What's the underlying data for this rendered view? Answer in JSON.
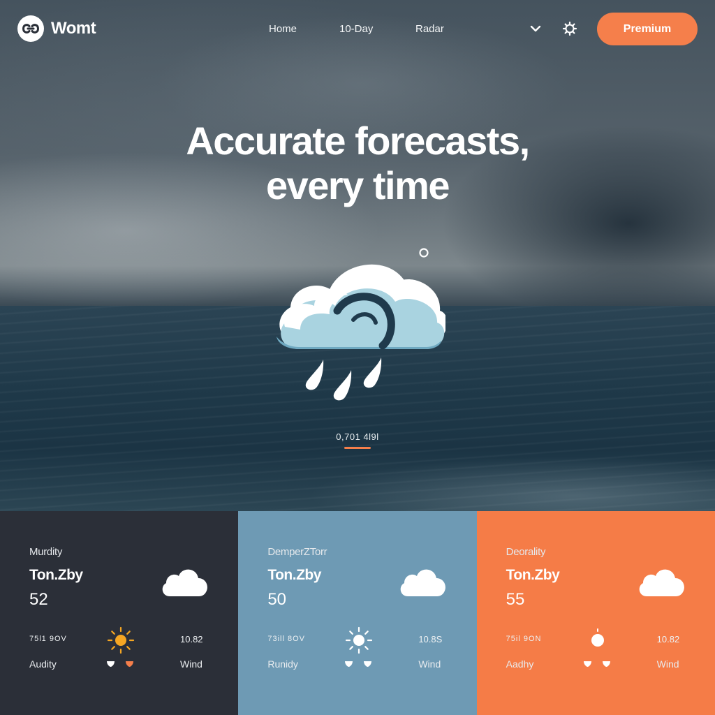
{
  "brand": {
    "name": "Womt"
  },
  "nav": {
    "links": [
      "Home",
      "10-Day",
      "Radar"
    ],
    "premium_label": "Premium"
  },
  "hero": {
    "headline_line1": "Accurate forecasts,",
    "headline_line2": "every time",
    "caption": "0,701 4l9l",
    "icon": "cloud-rain-icon",
    "accent_color": "#f57f4b"
  },
  "cards": [
    {
      "label": "Murdity",
      "sub": "Ton.Zby",
      "value": "52",
      "time": "75l1 9OV",
      "reading": "10.82",
      "metric": "Audity",
      "wind": "Wind",
      "bg": "#2b2f38",
      "sun_color": "#f5a623",
      "icon": "cloud-icon"
    },
    {
      "label": "DemperZTorr",
      "sub": "Ton.Zby",
      "value": "50",
      "time": "73ill 8OV",
      "reading": "10.8S",
      "metric": "Runidy",
      "wind": "Wind",
      "bg": "#6e9ab4",
      "sun_color": "#ffffff",
      "icon": "cloud-icon"
    },
    {
      "label": "Deorality",
      "sub": "Ton.Zby",
      "value": "55",
      "time": "75il 9ON",
      "reading": "10.82",
      "metric": "Aadhy",
      "wind": "Wind",
      "bg": "#f57c47",
      "sun_color": "#ffffff",
      "icon": "cloud-icon"
    }
  ]
}
